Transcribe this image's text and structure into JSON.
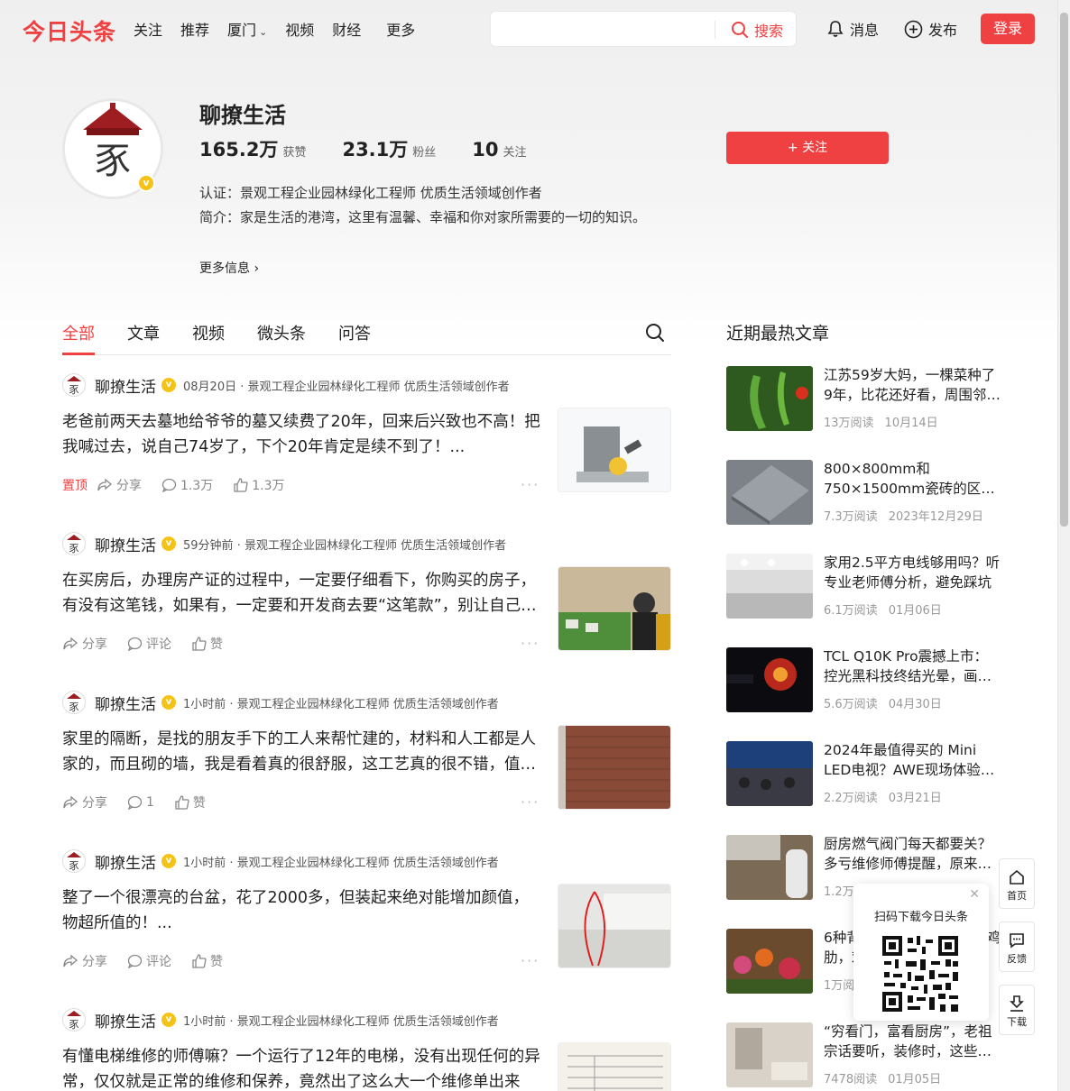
{
  "header": {
    "logo": "今日头条",
    "nav": [
      "关注",
      "推荐",
      "厦门",
      "视频",
      "财经",
      "更多"
    ],
    "search_placeholder": "",
    "search_label": "搜索",
    "messages_label": "消息",
    "publish_label": "发布",
    "login_label": "登录"
  },
  "profile": {
    "name": "聊撩生活",
    "stats": [
      {
        "num": "165.2万",
        "label": "获赞"
      },
      {
        "num": "23.1万",
        "label": "粉丝"
      },
      {
        "num": "10",
        "label": "关注"
      }
    ],
    "cert": "认证：景观工程企业园林绿化工程师 优质生活领域创作者",
    "bio": "简介：家是生活的港湾，这里有温馨、幸福和你对家所需要的一切的知识。",
    "more_info": "更多信息",
    "follow_label": "+ 关注"
  },
  "tabs": [
    "全部",
    "文章",
    "视频",
    "微头条",
    "问答"
  ],
  "feed": [
    {
      "author": "聊撩生活",
      "meta": "08月20日 · 景观工程企业园林绿化工程师 优质生活领域创作者",
      "text": "老爸前两天去墓地给爷爷的墓又续费了20年，回来后兴致也不高！把我喊过去，说自己74岁了，下个20年肯定是续不到了！...",
      "pinned": "置顶",
      "share": "分享",
      "comments": "1.3万",
      "likes": "1.3万"
    },
    {
      "author": "聊撩生活",
      "meta": "59分钟前 · 景观工程企业园林绿化工程师 优质生活领域创作者",
      "text": "在买房后，办理房产证的过程中，一定要仔细看下，你购买的房子，有没有这笔钱，如果有，一定要和开发商去要“这笔款”，别让自己吃亏了",
      "share": "分享",
      "comments": "评论",
      "likes": "赞"
    },
    {
      "author": "聊撩生活",
      "meta": "1小时前 · 景观工程企业园林绿化工程师 优质生活领域创作者",
      "text": "家里的隔断，是找的朋友手下的工人来帮忙建的，材料和人工都是人家的，而且砌的墙，我是看着真的很舒服，这工艺真的很不错，值得点赞",
      "share": "分享",
      "comments": "1",
      "likes": "赞"
    },
    {
      "author": "聊撩生活",
      "meta": "1小时前 · 景观工程企业园林绿化工程师 优质生活领域创作者",
      "text": "整了一个很漂亮的台盆，花了2000多，但装起来绝对能增加颜值，物超所值的！...",
      "share": "分享",
      "comments": "评论",
      "likes": "赞"
    },
    {
      "author": "聊撩生活",
      "meta": "1小时前 · 景观工程企业园林绿化工程师 优质生活领域创作者",
      "text": "有懂电梯维修的师傅嘛？一个运行了12年的电梯，没有出现任何的异常，仅仅就是正常的维修和保养，竟然出了这么大一个维修单出来",
      "share": "分享",
      "comments": "评论",
      "likes": "赞"
    }
  ],
  "sidebar": {
    "title": "近期最热文章",
    "items": [
      {
        "title": "江苏59岁大妈，一棵菜种了9年，比花还好看，周围邻居都来参观",
        "reads": "13万阅读",
        "date": "10月14日"
      },
      {
        "title": "800×800mm和750×1500mm瓷砖的区别，看完再选不后悔",
        "reads": "7.3万阅读",
        "date": "2023年12月29日"
      },
      {
        "title": "家用2.5平方电线够用吗？听专业老师傅分析，避免踩坑",
        "reads": "6.1万阅读",
        "date": "01月06日"
      },
      {
        "title": "TCL Q10K Pro震撼上市：控光黑科技终结光晕，画质再升级",
        "reads": "5.6万阅读",
        "date": "04月30日"
      },
      {
        "title": "2024年最值得买的 Mini LED电视？AWE现场体验告诉你答案",
        "reads": "2.2万阅读",
        "date": "03月21日"
      },
      {
        "title": "厨房燃气阀门每天都要关？多亏维修师傅提醒，原来这么多人做错了",
        "reads": "1.2万阅读",
        "date": ""
      },
      {
        "title": "6种背景墙千万别装，当成鸡肋，劝大家别跟风",
        "reads": "1万阅读",
        "date": ""
      },
      {
        "title": "“穷看门，富看厨房”，老祖宗话要听，装修时，这些地方不能省",
        "reads": "7478阅读",
        "date": "01月05日"
      }
    ]
  },
  "qr_popup": {
    "title": "扫码下载今日头条"
  },
  "float_buttons": {
    "home": "首页",
    "feedback": "反馈",
    "download": "下载"
  },
  "colors": {
    "brand": "#f04142",
    "verify": "#f5c317"
  }
}
